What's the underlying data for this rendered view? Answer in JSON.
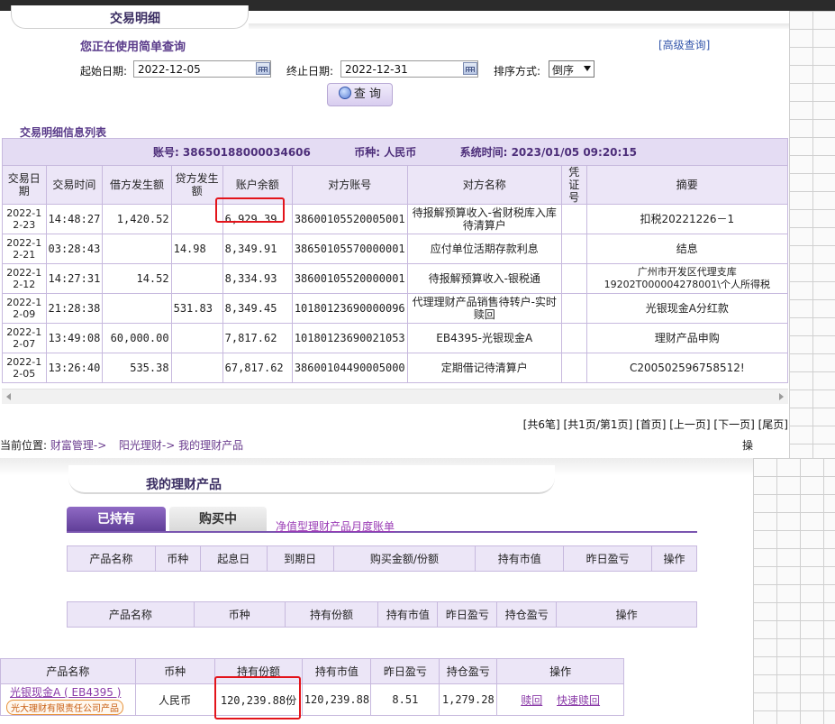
{
  "page": {
    "title": "交易明细",
    "subtitle": "您正在使用简单查询",
    "advanced_link": "[高级查询]",
    "list_title": "交易明细信息列表"
  },
  "filters": {
    "start_label": "起始日期:",
    "start_value": "2022-12-05",
    "end_label": "终止日期:",
    "end_value": "2022-12-31",
    "sort_label": "排序方式:",
    "sort_value": "倒序",
    "query_button": "查 询"
  },
  "account": {
    "account_no": "账号: 38650188000034606",
    "currency": "币种: 人民币",
    "system_time": "系统时间: 2023/01/05  09:20:15"
  },
  "detail_table": {
    "headers": [
      "交易日期",
      "交易时间",
      "借方发生额",
      "贷方发生额",
      "账户余额",
      "对方账号",
      "对方名称",
      "凭证号",
      "摘要"
    ],
    "rows": [
      {
        "date": "2022-12-23",
        "time": "14:48:27",
        "debit": "1,420.52",
        "credit": "",
        "balance": "6,929.39",
        "cp_account": "38600105520005001",
        "cp_name": "待报解预算收入-省财税库入库待清算户",
        "voucher": "",
        "memo": "扣税20221226－1"
      },
      {
        "date": "2022-12-21",
        "time": "03:28:43",
        "debit": "",
        "credit": "14.98",
        "balance": "8,349.91",
        "cp_account": "38650105570000001",
        "cp_name": "应付单位活期存款利息",
        "voucher": "",
        "memo": "结息"
      },
      {
        "date": "2022-12-12",
        "time": "14:27:31",
        "debit": "14.52",
        "credit": "",
        "balance": "8,334.93",
        "cp_account": "38600105520000001",
        "cp_name": "待报解预算收入-银税通",
        "voucher": "",
        "memo": "广州市开发区代理支库 19202T000004278001\\个人所得税"
      },
      {
        "date": "2022-12-09",
        "time": "21:28:38",
        "debit": "",
        "credit": "531.83",
        "balance": "8,349.45",
        "cp_account": "10180123690000096",
        "cp_name": "代理理财产品销售待转户-实时赎回",
        "voucher": "",
        "memo": "光银现金A分红款"
      },
      {
        "date": "2022-12-07",
        "time": "13:49:08",
        "debit": "60,000.00",
        "credit": "",
        "balance": "7,817.62",
        "cp_account": "10180123690021053",
        "cp_name": "EB4395-光银现金A",
        "voucher": "",
        "memo": "理财产品申购"
      },
      {
        "date": "2022-12-05",
        "time": "13:26:40",
        "debit": "535.38",
        "credit": "",
        "balance": "67,817.62",
        "cp_account": "38600104490005000",
        "cp_name": "定期借记待清算户",
        "voucher": "",
        "memo": "C200502596758512!"
      }
    ]
  },
  "pager": {
    "total": "[共6笔]",
    "pages": "[共1页/第1页]",
    "first": "[首页]",
    "prev": "[上一页]",
    "next": "[下一页]",
    "last": "[尾页]"
  },
  "breadcrumb": {
    "prefix": "当前位置:",
    "item1": "财富管理->",
    "item2": "阳光理财->",
    "item3": "我的理财产品",
    "cut": "操"
  },
  "products": {
    "title": "我的理财产品",
    "tab_holding": "已持有",
    "tab_buying": "购买中",
    "monthly_link": "净值型理财产品月度账单",
    "table1_headers": [
      "产品名称",
      "币种",
      "起息日",
      "到期日",
      "购买金额/份额",
      "持有市值",
      "昨日盈亏",
      "操作"
    ],
    "table2_headers": [
      "产品名称",
      "币种",
      "持有份额",
      "持有市值",
      "昨日盈亏",
      "持仓盈亏",
      "操作"
    ],
    "table3_headers": [
      "产品名称",
      "币种",
      "持有份额",
      "持有市值",
      "昨日盈亏",
      "持仓盈亏",
      "操作"
    ],
    "holding": {
      "name": "光银现金A ( EB4395 )",
      "issuer": "光大理财有限责任公司产品",
      "currency": "人民币",
      "shares": "120,239.88份",
      "market_value": "120,239.88",
      "yesterday_pnl": "8.51",
      "position_pnl": "1,279.28",
      "op_redeem": "赎回",
      "op_quick_redeem": "快速赎回"
    }
  },
  "colors": {
    "accent_purple": "#5f3d97",
    "header_bg": "#ece6f7",
    "highlight_red": "#e3141b"
  }
}
